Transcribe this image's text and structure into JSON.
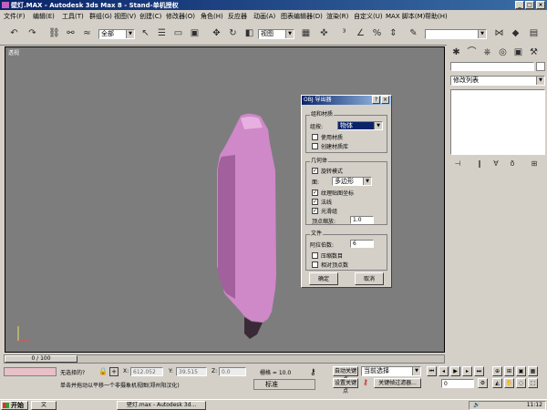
{
  "window": {
    "title": "壁灯.MAX - Autodesk 3ds Max 8 - Stand-单机授权"
  },
  "menu": [
    "文件(F)",
    "编辑(E)",
    "工具(T)",
    "群组(G)",
    "视图(V)",
    "创建(C)",
    "修改器(O)",
    "角色(H)",
    "反应器",
    "动画(A)",
    "图表编辑器(D)",
    "渲染(R)",
    "自定义(U)",
    "MAX 脚本(M)",
    "帮助(H)"
  ],
  "toolbar": {
    "selection_filter": "全部",
    "ref_coord": "视图"
  },
  "viewport": {
    "label": "透视"
  },
  "command_panel": {
    "modifier_list": "修改列表"
  },
  "dialog": {
    "title": "OBJ 导出器",
    "group_materials": "组和材质",
    "group_label": "组按:",
    "group_value": "物体",
    "use_materials": "使用材质",
    "create_material_lib": "创建材质库",
    "group_geometry": "几何体",
    "rotate_model": "旋转模式",
    "faces_label": "面:",
    "faces_value": "多边形",
    "texture_coords": "纹理贴图坐标",
    "normals": "法线",
    "smoothing_groups": "光滑组",
    "vertex_scale_label": "顶点缩放:",
    "vertex_scale_value": "1.0",
    "group_file": "文件",
    "digits_label": "阿拉伯数:",
    "digits_value": "6",
    "compress_numbers": "压缩数目",
    "relative_vertices": "相对顶点数",
    "ok": "确定",
    "cancel": "取消"
  },
  "timeline": {
    "frame": "0 / 100"
  },
  "status": {
    "selection": "无选择的?",
    "prompt": "单击并拖动以平移一个非摄象机视图(郑州阳汉化)",
    "x_label": "X:",
    "x_value": "612.052",
    "y_label": "Y:",
    "y_value": "39.515",
    "z_label": "Z:",
    "z_value": "0.0",
    "grid": "栅格 = 10.0",
    "auto_key": "自动关键点",
    "set_key": "设置关键点",
    "key_mode": "当前选择",
    "key_filters": "关键帧过滤器...",
    "frame_field": "0",
    "ime_label": "标准"
  },
  "taskbar": {
    "start": "开始",
    "app1": "文",
    "app2": "壁灯.max - Autodesk 3d...",
    "time": "11:12"
  },
  "colors": {
    "viewport_bg": "#7d7d7d",
    "object": "#d48fcf",
    "title_blue": "#0a246a"
  }
}
